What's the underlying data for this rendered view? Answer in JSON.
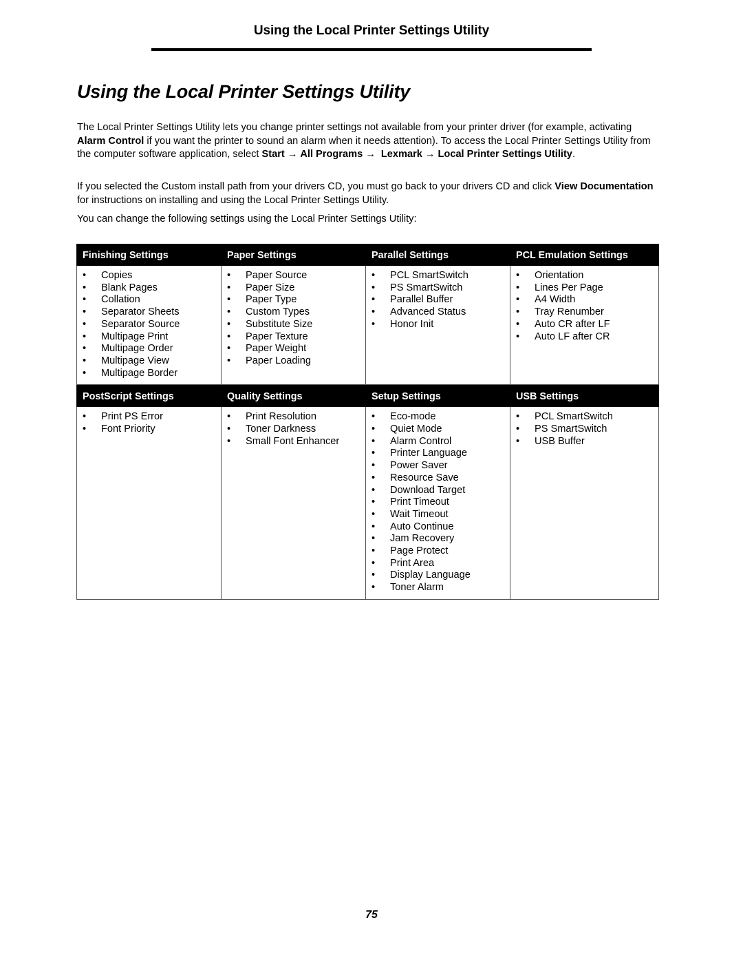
{
  "running_header": "Using the Local Printer Settings Utility",
  "title": "Using the Local Printer Settings Utility",
  "paragraphs": {
    "p1": {
      "t1": "The Local Printer Settings Utility lets you change printer settings not available from your printer driver (for example, activating ",
      "b1": "Alarm Control",
      "t2": " if you want the printer to sound an alarm when it needs attention). To access the Local Printer Settings Utility from the computer software application, select ",
      "b2": "Start",
      "b3": "All Programs",
      "b4": "Lexmark",
      "b5": "Local Printer Settings Utility",
      "t3": ".",
      "arrow": "→"
    },
    "p2": {
      "t1": "If you selected the Custom install path from your drivers CD, you must go back to your drivers CD and click ",
      "b1": "View Documentation",
      "t2": " for instructions on installing and using the Local Printer Settings Utility."
    },
    "p3": "You can change the following settings using the Local Printer Settings Utility:"
  },
  "table": {
    "bullet": "•",
    "row1": [
      {
        "header": "Finishing Settings",
        "items": [
          "Copies",
          "Blank Pages",
          "Collation",
          "Separator Sheets",
          "Separator Source",
          "Multipage Print",
          "Multipage Order",
          "Multipage View",
          "Multipage Border"
        ]
      },
      {
        "header": "Paper Settings",
        "items": [
          "Paper Source",
          "Paper Size",
          "Paper Type",
          "Custom Types",
          "Substitute Size",
          "Paper Texture",
          "Paper Weight",
          "Paper Loading"
        ]
      },
      {
        "header": "Parallel Settings",
        "items": [
          "PCL SmartSwitch",
          "PS SmartSwitch",
          "Parallel Buffer",
          "Advanced Status",
          "Honor Init"
        ]
      },
      {
        "header": "PCL Emulation Settings",
        "items": [
          "Orientation",
          "Lines Per Page",
          "A4 Width",
          "Tray Renumber",
          "Auto CR after LF",
          "Auto LF after CR"
        ]
      }
    ],
    "row2": [
      {
        "header": "PostScript Settings",
        "items": [
          "Print PS Error",
          "Font Priority"
        ]
      },
      {
        "header": "Quality Settings",
        "items": [
          "Print Resolution",
          "Toner Darkness",
          "Small Font Enhancer"
        ]
      },
      {
        "header": "Setup Settings",
        "items": [
          "Eco-mode",
          "Quiet Mode",
          "Alarm Control",
          "Printer Language",
          "Power Saver",
          "Resource Save",
          "Download Target",
          "Print Timeout",
          "Wait Timeout",
          "Auto Continue",
          "Jam Recovery",
          "Page Protect",
          "Print Area",
          "Display Language",
          "Toner Alarm"
        ]
      },
      {
        "header": "USB Settings",
        "items": [
          "PCL SmartSwitch",
          "PS SmartSwitch",
          "USB Buffer"
        ]
      }
    ]
  },
  "page_number": "75"
}
